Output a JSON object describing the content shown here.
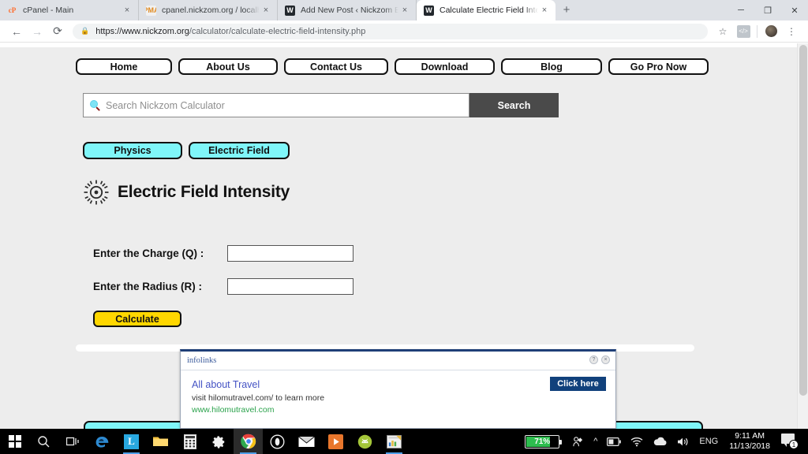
{
  "browser": {
    "tabs": [
      {
        "title": "cPanel - Main",
        "favicon": "cpanel-icon",
        "active": false
      },
      {
        "title": "cpanel.nickzom.org / localhost | p",
        "favicon": "phpmyadmin-icon",
        "active": false
      },
      {
        "title": "Add New Post ‹ Nickzom Blog —",
        "favicon": "wordpress-icon",
        "active": false
      },
      {
        "title": "Calculate Electric Field Intensity |",
        "favicon": "wordpress-icon",
        "active": true
      }
    ],
    "new_tab_label": "+",
    "close_label": "×",
    "window_controls": {
      "minimize": "─",
      "maximize": "❐",
      "close": "✕"
    },
    "nav": {
      "back": "←",
      "forward": "→",
      "reload": "⟳"
    },
    "address": {
      "lock_icon": "lock-icon",
      "host": "https://www.nickzom.org",
      "path": "/calculator/calculate-electric-field-intensity.php"
    },
    "toolbar_icons": {
      "bookmark": "star-icon",
      "extension": "code-extension-icon",
      "profile": "avatar-icon",
      "menu": "kebab-menu-icon"
    }
  },
  "site": {
    "nav_items": [
      {
        "label": "Home"
      },
      {
        "label": "About Us"
      },
      {
        "label": "Contact Us"
      },
      {
        "label": "Download"
      },
      {
        "label": "Blog"
      },
      {
        "label": "Go Pro Now"
      }
    ],
    "search": {
      "placeholder": "Search Nickzom Calculator",
      "value": "",
      "icon": "magnifier-icon",
      "button_label": "Search"
    },
    "tags": [
      {
        "label": "Physics"
      },
      {
        "label": "Electric Field"
      }
    ],
    "page": {
      "icon": "sun-burst-icon",
      "title": "Electric Field Intensity"
    },
    "form": {
      "fields": [
        {
          "label": "Enter the Charge (Q) :",
          "value": ""
        },
        {
          "label": "Enter the Radius (R) :",
          "value": ""
        }
      ],
      "submit_label": "Calculate"
    }
  },
  "ad": {
    "brand": "infolinks",
    "help_label": "?",
    "close_label": "×",
    "title": "All about Travel",
    "description": "visit hilomutravel.com/ to learn more",
    "url": "www.hilomutravel.com",
    "cta_label": "Click here"
  },
  "taskbar": {
    "items": [
      {
        "name": "start-button",
        "icon": "windows-logo-icon"
      },
      {
        "name": "search-button",
        "icon": "search-icon"
      },
      {
        "name": "task-view-button",
        "icon": "task-view-icon"
      },
      {
        "name": "edge-button",
        "icon": "edge-icon"
      },
      {
        "name": "app-l-button",
        "icon": "letter-l-icon"
      },
      {
        "name": "file-explorer-button",
        "icon": "folder-icon"
      },
      {
        "name": "calculator-button",
        "icon": "calculator-icon"
      },
      {
        "name": "settings-button",
        "icon": "gear-icon"
      },
      {
        "name": "chrome-button",
        "icon": "chrome-icon"
      },
      {
        "name": "opera-button",
        "icon": "opera-icon"
      },
      {
        "name": "mail-button",
        "icon": "mail-icon"
      },
      {
        "name": "video-button",
        "icon": "video-player-icon"
      },
      {
        "name": "android-studio-button",
        "icon": "android-icon"
      },
      {
        "name": "excel-button",
        "icon": "spreadsheet-icon"
      }
    ],
    "tray": {
      "battery_percent": "71%",
      "pen_icon": "pen-workspace-icon",
      "overflow_icon": "chevron-up-icon",
      "battery_icon": "battery-icon",
      "wifi_icon": "wifi-icon",
      "onedrive_icon": "cloud-icon",
      "volume_icon": "speaker-icon",
      "language": "ENG",
      "time": "9:11 AM",
      "date": "11/13/2018",
      "notification_count": "1",
      "notification_icon": "action-center-icon"
    }
  },
  "colors": {
    "page_bg": "#ededed",
    "tag_cyan": "#7ff6f9",
    "button_yellow": "#ffd700",
    "search_btn": "#4a4a4a",
    "ad_blue": "#11417c"
  }
}
